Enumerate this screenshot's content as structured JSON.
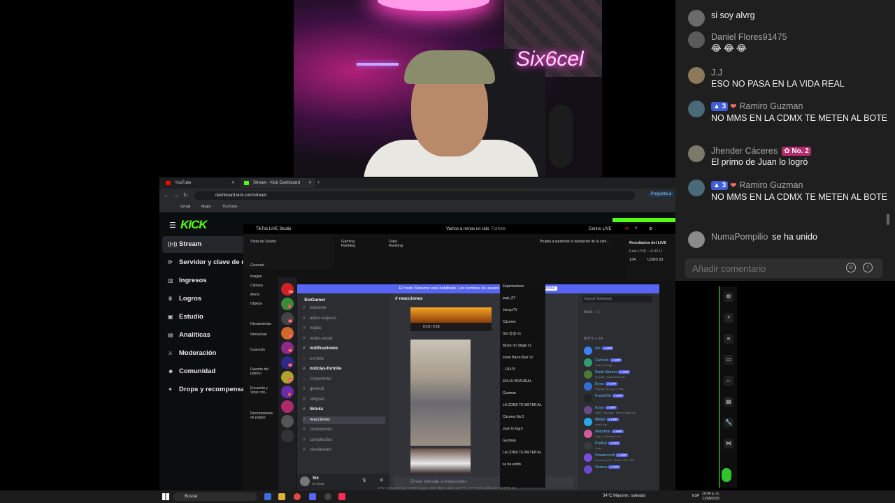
{
  "webcam": {
    "logo_text": "Six6cel"
  },
  "chat": {
    "messages": [
      {
        "user": "",
        "text": "si soy alvrg",
        "avatar_color": "#6b6b6b"
      },
      {
        "user": "Daniel Flores91475",
        "text": "😂 😂 😂",
        "avatar_color": "#5a5a5a"
      },
      {
        "user": "J.J",
        "text": "ESO NO PASA EN LA VIDA REAL",
        "avatar_color": "#8a7a5a"
      },
      {
        "user": "Ramiro Guzman",
        "level": "3",
        "text": "NO MMS EN LA CDMX TE METEN AL BOTE",
        "avatar_color": "#4a6a7a"
      },
      {
        "user": "Jhender Cáceres",
        "rank": "No. 2",
        "text": "El primo de Juan lo logró",
        "avatar_color": "#7a7a6a"
      },
      {
        "user": "Ramiro Guzman",
        "level": "3",
        "text": "NO MMS EN LA CDMX TE METEN AL BOTE",
        "avatar_color": "#4a6a7a"
      },
      {
        "user": "NumaPompilio",
        "text": "se ha unido",
        "avatar_color": "#8a8a8a"
      }
    ],
    "input_placeholder": "Añadir comentario"
  },
  "browser": {
    "tabs": [
      {
        "label": "YouTube",
        "color": "#ff0000"
      },
      {
        "label": "Stream - Kick Dashboard",
        "color": "#53fc18"
      }
    ],
    "url": "dashboard.kick.com/stream",
    "pregunta": "Pregunta a",
    "bookmarks": [
      "Gmail",
      "Maps",
      "YouTube"
    ]
  },
  "kick": {
    "logo": "KICK",
    "nav": [
      {
        "label": "Stream",
        "icon": "broadcast-icon",
        "glyph": "((•))"
      },
      {
        "label": "Servidor y clave de re",
        "icon": "server-icon",
        "glyph": "⟳"
      },
      {
        "label": "Ingresos",
        "icon": "money-icon",
        "glyph": "▥"
      },
      {
        "label": "Logros",
        "icon": "trophy-icon",
        "glyph": "♛"
      },
      {
        "label": "Estudio",
        "icon": "studio-icon",
        "glyph": "▣"
      },
      {
        "label": "Analíticas",
        "icon": "analytics-icon",
        "glyph": "▤"
      },
      {
        "label": "Moderación",
        "icon": "sword-icon",
        "glyph": "⚔"
      },
      {
        "label": "Comunidad",
        "icon": "community-icon",
        "glyph": "☻"
      },
      {
        "label": "Drops y recompensas",
        "icon": "gift-icon",
        "glyph": "✦"
      }
    ]
  },
  "tiktok": {
    "title": "TikTok LIVE Studio",
    "live_title": "Vamos a reinos un rato",
    "game": "Fortnite",
    "centro": "Centro LIVE",
    "vista": "Vista de Studio",
    "general": "General",
    "gaming_ranking": "Gaming Ranking",
    "daily_ranking": "Daily Ranking",
    "resolution_tip": "Prueba a aumentar la resolución de la cám...",
    "resultados": "Resultados del LIVE",
    "este_live": "Este LIVE: +0.03 U",
    "viewers": "134",
    "usd": "USD0.53",
    "left_items": [
      "Imagen",
      "Cámara",
      "Alerta",
      "Objetos",
      "Herramientas",
      "Interactuar",
      "Coanción",
      "Favorito del público",
      "Encuesta y Votar con...",
      "Recompensas de juegos"
    ]
  },
  "discord": {
    "banner": "El modo Streamer está habilitado. Los nombres de usuario se han truncado.",
    "banner_button": "Deshabilitar",
    "window_title": "SixGamer",
    "server_name": "SixGamer",
    "channels": [
      {
        "name": "welcome",
        "style": ""
      },
      {
        "name": "adios-vaquero",
        "style": ""
      },
      {
        "name": "reglas",
        "style": ""
      },
      {
        "name": "redes-social",
        "style": ""
      },
      {
        "name": "notificaciones",
        "style": "bright"
      },
      {
        "name": "EXTRAS",
        "style": "cat"
      },
      {
        "name": "noticias-fortnite",
        "style": "bright"
      },
      {
        "name": "COMUNIDAD",
        "style": "cat"
      },
      {
        "name": "general",
        "style": ""
      },
      {
        "name": "shitpost",
        "style": ""
      },
      {
        "name": "tiktoks",
        "style": "bright"
      },
      {
        "name": "reacciones",
        "style": "sel"
      },
      {
        "name": "confesiones",
        "style": ""
      },
      {
        "name": "cumpleaños",
        "style": ""
      },
      {
        "name": "charlatanes",
        "style": ""
      }
    ],
    "current_channel": "reacciones",
    "player_time": "0:18 / 0:18",
    "compose_placeholder": "Enviar mensaje a #reacciones",
    "search_placeholder": "Buscar SixGamer",
    "user_name": "Six",
    "user_status": "En línea",
    "members_mods": "Mods — 1",
    "members_bots": "BOTS — 14",
    "bots": [
      {
        "name": "Aki",
        "sub": "",
        "color": "#3b82f6"
      },
      {
        "name": "Carl-bot",
        "sub": "/help | carl.gg",
        "color": "#2f9e6e"
      },
      {
        "name": "Dank Memer",
        "sub": "pls play | dankmemer.lol",
        "color": "#4a7a3a"
      },
      {
        "name": "Dyno",
        "sub": "Playing dyno.gg | ?help",
        "color": "#2f6ed4"
      },
      {
        "name": "FreshTok",
        "sub": "",
        "color": "#222"
      },
      {
        "name": "Koya",
        "sub": "/help · koya.gg · discord.gg/koya",
        "color": "#6a4a8a"
      },
      {
        "name": "MEE6",
        "sub": "mee6.xyz",
        "color": "#2aa7e8"
      },
      {
        "name": "Nekotina",
        "sub": "/help · nekotina.com",
        "color": "#d35a9a"
      },
      {
        "name": "ProBot",
        "sub": "/help",
        "color": "#3a3a3a"
      },
      {
        "name": "Streamcord",
        "sub": "streamcord.io · Shard 228 / 800",
        "color": "#7b4ee0"
      },
      {
        "name": "Voxera",
        "sub": "",
        "color": "#6a4aca"
      }
    ],
    "server_badges": [
      "RB",
      "5",
      "60",
      "40",
      "40",
      "22",
      "60",
      "6"
    ]
  },
  "tt_chat": {
    "lines": [
      "Espectadores",
      "pupi_67",
      "JumpzTV",
      "Cáceres",
      "GG 😍😍 x1",
      "Music on Stage x1",
      "envió Barra flúor x1",
      "...91475",
      "EN LA VIDA REAL",
      "Guzman",
      "LA CDMX TE METEN AL",
      "Cáceres No.2",
      "Juan lo logró",
      "Guzman",
      "LA CDMX TE METEN AL",
      "se ha unido"
    ]
  },
  "tools": [
    "settings-icon",
    "bolt-icon",
    "list-icon",
    "chat-icon",
    "code-icon",
    "stack-icon",
    "wrench-icon",
    "share-icon"
  ],
  "status_text": "CPU: 2.8%    Memoria: 0.8GB    Cargas: 3593 kbps    Caídas de FPS: 0    FPS del codificador: 34    FPS: 34",
  "taskbar": {
    "search": "Buscar",
    "weather": "34°C  Mayorm. soleado",
    "lang": "ESP",
    "time": "10:04 p. m.",
    "date": "11/08/2025"
  }
}
